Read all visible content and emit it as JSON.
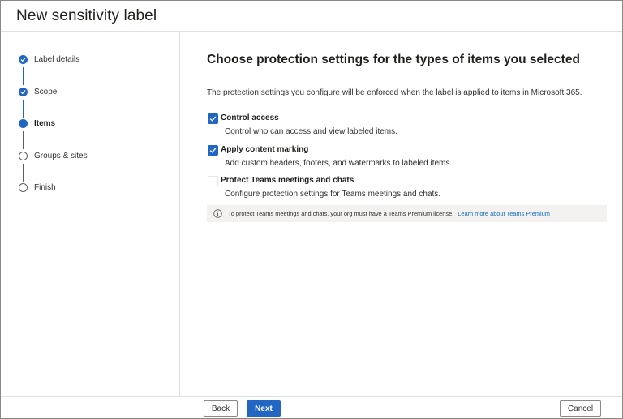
{
  "header": {
    "title": "New sensitivity label"
  },
  "steps": [
    {
      "label": "Label details",
      "state": "done"
    },
    {
      "label": "Scope",
      "state": "done"
    },
    {
      "label": "Items",
      "state": "current"
    },
    {
      "label": "Groups & sites",
      "state": "todo"
    },
    {
      "label": "Finish",
      "state": "todo"
    }
  ],
  "main": {
    "heading": "Choose protection settings for the types of items you selected",
    "description": "The protection settings you configure will be enforced when the label is applied to items in Microsoft 365.",
    "options": [
      {
        "title": "Control access",
        "subtitle": "Control who can access and view labeled items.",
        "checked": true
      },
      {
        "title": "Apply content marking",
        "subtitle": "Add custom headers, footers, and watermarks to labeled items.",
        "checked": true
      },
      {
        "title": "Protect Teams meetings and chats",
        "subtitle": "Configure protection settings for Teams meetings and chats.",
        "checked": false
      }
    ],
    "info": {
      "text": "To protect Teams meetings and chats, your org must have a Teams Premium license.",
      "link": "Learn more about Teams Premium"
    }
  },
  "footer": {
    "back": "Back",
    "next": "Next",
    "cancel": "Cancel"
  },
  "colors": {
    "accent": "#2266c3",
    "link": "#0f6cbd"
  }
}
